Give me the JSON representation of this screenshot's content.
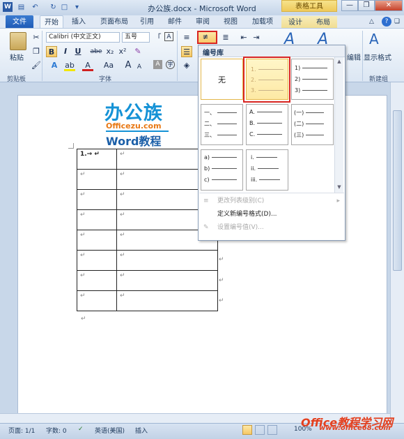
{
  "window": {
    "title": "办公族.docx - Microsoft Word",
    "context_tab_group": "表格工具",
    "app_letter": "W"
  },
  "tabs": [
    "文件",
    "开始",
    "插入",
    "页面布局",
    "引用",
    "邮件",
    "审阅",
    "视图",
    "加载项",
    "设计",
    "布局"
  ],
  "ribbon": {
    "paste_label": "粘贴",
    "clipboard_group": "剪贴板",
    "font_name": "Calibri (中文正文)",
    "font_size": "五号",
    "font_group": "字体",
    "format_buttons": [
      "B",
      "I",
      "U",
      "abe",
      "x₂",
      "x²"
    ],
    "right_label_edit": "编辑",
    "show_format_label": "显示格式",
    "new_group_label": "新建组",
    "font_size_grow": "A",
    "font_size_shrink": "A",
    "aa_label": "Aa"
  },
  "numbering_dropdown": {
    "header": "编号库",
    "none_label": "无",
    "thumbnails": [
      {
        "lines": [
          "1.",
          "2.",
          "3."
        ]
      },
      {
        "lines": [
          "1)",
          "2)",
          "3)"
        ]
      },
      {
        "lines": [
          "一、",
          "二、",
          "三、"
        ]
      },
      {
        "lines": [
          "A.",
          "B.",
          "C."
        ]
      },
      {
        "lines": [
          "(一)",
          "(二)",
          "(三)"
        ]
      },
      {
        "lines": [
          "a)",
          "b)",
          "c)"
        ]
      },
      {
        "lines": [
          "i.",
          "ii.",
          "iii."
        ]
      }
    ],
    "menu_items": [
      {
        "label": "更改列表级别(C)",
        "enabled": false
      },
      {
        "label": "定义新编号格式(D)...",
        "enabled": true
      },
      {
        "label": "设置编号值(V)...",
        "enabled": false
      }
    ]
  },
  "document": {
    "logo_text": "办公族",
    "logo_domain": "Officezu.com",
    "logo_subtitle": "Word教程",
    "table_first_cell": "1.→ ↵",
    "cell_mark": "↵",
    "row_end_mark": "↵",
    "para_mark": "↵"
  },
  "statusbar": {
    "page": "页面: 1/1",
    "words": "字数: 0",
    "language": "英语(美国)",
    "mode": "插入",
    "zoom": "100%"
  },
  "watermark": {
    "line1": "Office教程学习网",
    "line2": "www.office68.com"
  }
}
